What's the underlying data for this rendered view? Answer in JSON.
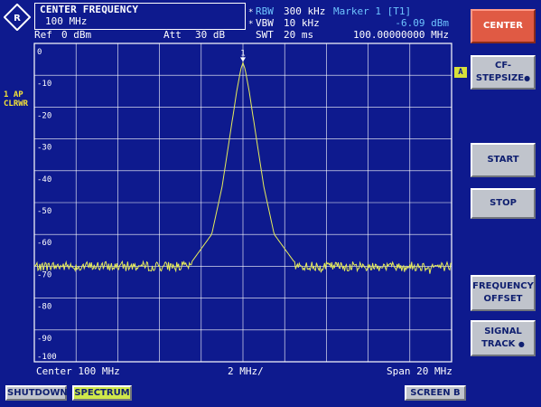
{
  "header": {
    "center_freq_title": "CENTER FREQUENCY",
    "center_freq_value": "100 MHz",
    "ref_label": "Ref",
    "ref_value": "0 dBm",
    "att_label": "Att",
    "att_value": "30 dB",
    "rbw_label": "RBW",
    "rbw_value": "300 kHz",
    "vbw_label": "VBW",
    "vbw_value": "10 kHz",
    "swt_label": "SWT",
    "swt_value": "20 ms",
    "marker_label": "Marker 1 [T1]",
    "marker_level": "-6.09 dBm",
    "marker_freq": "100.00000000 MHz",
    "coupled_mark": "*"
  },
  "trace_info": {
    "line1": "1 AP",
    "line2": "CLRWR",
    "marker_box": "A"
  },
  "footer": {
    "center": "Center 100 MHz",
    "div": "2 MHz/",
    "span": "Span 20 MHz"
  },
  "softkeys": [
    {
      "label": "CENTER",
      "active": true
    },
    {
      "label": "CF-",
      "label2": "STEPSIZE"
    },
    {
      "label": "START"
    },
    {
      "label": "STOP"
    },
    {
      "label": "FREQUENCY",
      "label2": "OFFSET"
    },
    {
      "label": "SIGNAL",
      "label2": "TRACK"
    }
  ],
  "bottom": {
    "shutdown": "SHUTDOWN",
    "spectrum": "SPECTRUM",
    "screen": "SCREEN B"
  },
  "colors": {
    "background": "#0e1a8e",
    "grid": "#ffffff",
    "trace": "#e6ec5a",
    "info_text": "#6ec4ff",
    "trace_label": "#f2e038",
    "active_softkey": "#e05a44"
  },
  "chart_data": {
    "type": "line",
    "xlabel": "",
    "ylabel": "",
    "x_unit": "MHz",
    "y_unit": "dBm",
    "xlim": [
      90,
      110
    ],
    "ylim": [
      -100,
      0
    ],
    "y_ticks": [
      "0",
      "-10",
      "-20",
      "-30",
      "-40",
      "-50",
      "-60",
      "-70",
      "-80",
      "-90",
      "-100"
    ],
    "grid": true,
    "noise_floor_dbm": -70,
    "series": [
      {
        "x": [
          90,
          95.5,
          97.5,
          98.5,
          99.0,
          99.4,
          99.7,
          99.9,
          100.0,
          100.1,
          100.3,
          100.6,
          101.0,
          101.5,
          102.5,
          104.5,
          110
        ],
        "y": [
          -70,
          -70,
          -69,
          -60,
          -45,
          -28,
          -15,
          -8,
          -6.09,
          -8,
          -15,
          -28,
          -45,
          -60,
          -69,
          -70,
          -70
        ]
      }
    ],
    "marker": {
      "x": 100,
      "y": -6.09,
      "label": "1"
    }
  }
}
